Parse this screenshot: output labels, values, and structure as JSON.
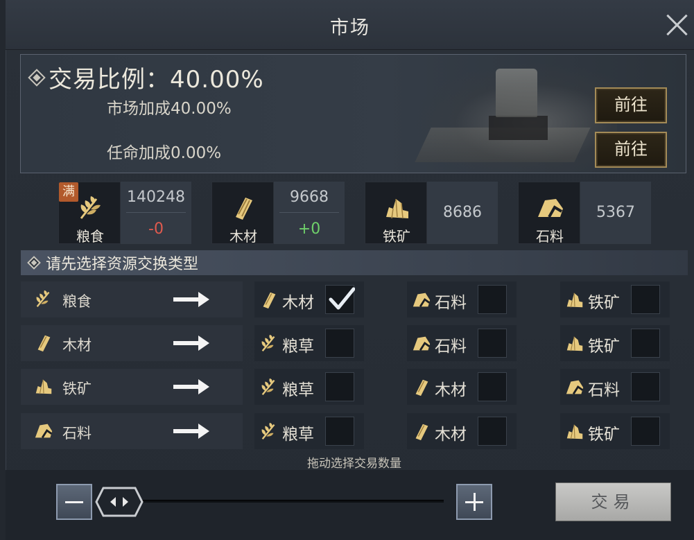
{
  "window": {
    "title": "市场"
  },
  "ratio": {
    "title": "交易比例：40.00%",
    "market_bonus": "市场加成40.00%",
    "appoint_bonus": "任命加成0.00%",
    "goto_label_1": "前往",
    "goto_label_2": "前往"
  },
  "resources": [
    {
      "name": "粮食",
      "amount": "140248",
      "delta": "-0",
      "delta_color": "#e05a4e",
      "badge": "满",
      "icon": "grain-icon"
    },
    {
      "name": "木材",
      "amount": "9668",
      "delta": "+0",
      "delta_color": "#6fd06a",
      "icon": "wood-icon"
    },
    {
      "name": "铁矿",
      "amount": "8686",
      "icon": "iron-ore-icon"
    },
    {
      "name": "石料",
      "amount": "5367",
      "icon": "stone-icon"
    }
  ],
  "exchange": {
    "header": "请先选择资源交换类型",
    "rows": [
      {
        "source": "粮食",
        "targets": [
          {
            "label": "木材",
            "checked": true
          },
          {
            "label": "石料",
            "checked": false
          },
          {
            "label": "铁矿",
            "checked": false
          }
        ]
      },
      {
        "source": "木材",
        "targets": [
          {
            "label": "粮草",
            "checked": false
          },
          {
            "label": "石料",
            "checked": false
          },
          {
            "label": "铁矿",
            "checked": false
          }
        ]
      },
      {
        "source": "铁矿",
        "targets": [
          {
            "label": "粮草",
            "checked": false
          },
          {
            "label": "木材",
            "checked": false
          },
          {
            "label": "石料",
            "checked": false
          }
        ]
      },
      {
        "source": "石料",
        "targets": [
          {
            "label": "粮草",
            "checked": false
          },
          {
            "label": "木材",
            "checked": false
          },
          {
            "label": "铁矿",
            "checked": false
          }
        ]
      }
    ]
  },
  "trade": {
    "drag_hint": "拖动选择交易数量",
    "trade_label": "交易",
    "slider_fraction": 0
  },
  "colors": {
    "gold": "#d9b874",
    "accent_border": "#a48b57"
  }
}
